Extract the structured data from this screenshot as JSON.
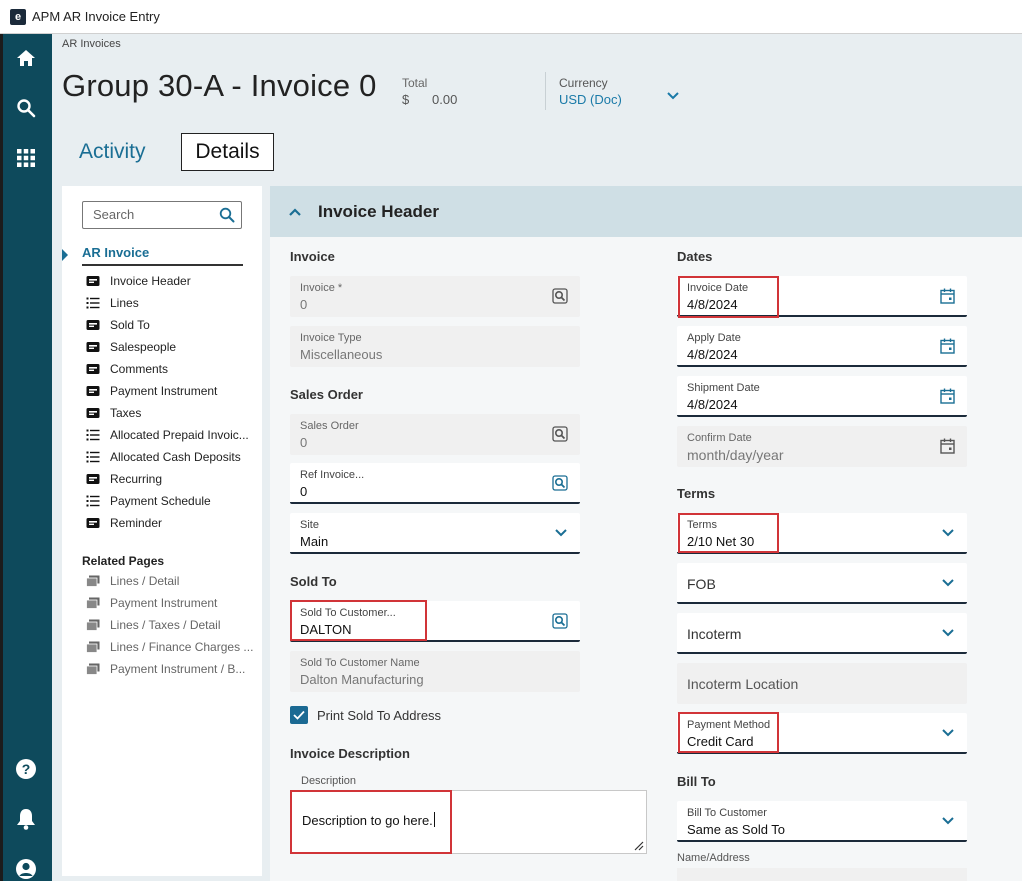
{
  "window": {
    "title": "APM AR Invoice Entry",
    "app_icon_letter": "e"
  },
  "rail": {
    "icons": [
      "home-icon",
      "search-icon",
      "apps-grid-icon",
      "help-icon",
      "bell-icon",
      "user-icon"
    ]
  },
  "header": {
    "breadcrumb": "AR Invoices",
    "title": "Group 30-A - Invoice 0",
    "total_label": "Total",
    "total_currency_symbol": "$",
    "total_value": "0.00",
    "currency_label": "Currency",
    "currency_value": "USD (Doc)"
  },
  "tabs": {
    "activity": "Activity",
    "details": "Details",
    "active": "Details"
  },
  "nav": {
    "search_placeholder": "Search",
    "section": "AR Invoice",
    "items": [
      {
        "label": "Invoice Header",
        "icon": "card-icon"
      },
      {
        "label": "Lines",
        "icon": "list-icon"
      },
      {
        "label": "Sold To",
        "icon": "card-icon"
      },
      {
        "label": "Salespeople",
        "icon": "card-icon"
      },
      {
        "label": "Comments",
        "icon": "card-icon"
      },
      {
        "label": "Payment Instrument",
        "icon": "card-icon"
      },
      {
        "label": "Taxes",
        "icon": "card-icon"
      },
      {
        "label": "Allocated Prepaid Invoic...",
        "icon": "list-icon"
      },
      {
        "label": "Allocated Cash Deposits",
        "icon": "list-icon"
      },
      {
        "label": "Recurring",
        "icon": "card-icon"
      },
      {
        "label": "Payment Schedule",
        "icon": "list-icon"
      },
      {
        "label": "Reminder",
        "icon": "card-icon"
      }
    ],
    "related_title": "Related Pages",
    "related": [
      {
        "label": "Lines / Detail"
      },
      {
        "label": "Payment Instrument"
      },
      {
        "label": "Lines / Taxes / Detail"
      },
      {
        "label": "Lines / Finance Charges ..."
      },
      {
        "label": "Payment Instrument / B..."
      }
    ]
  },
  "section": {
    "title": "Invoice Header"
  },
  "left": {
    "invoice_group": "Invoice",
    "invoice": {
      "label": "Invoice *",
      "value": "0"
    },
    "invoice_type": {
      "label": "Invoice Type",
      "value": "Miscellaneous"
    },
    "sales_order_group": "Sales Order",
    "sales_order": {
      "label": "Sales Order",
      "value": "0"
    },
    "ref_invoice": {
      "label": "Ref Invoice...",
      "value": "0"
    },
    "site": {
      "label": "Site",
      "value": "Main"
    },
    "sold_to_group": "Sold To",
    "sold_to_customer": {
      "label": "Sold To Customer...",
      "value": "DALTON"
    },
    "sold_to_name": {
      "label": "Sold To Customer Name",
      "value": "Dalton Manufacturing"
    },
    "print_address": {
      "label": "Print Sold To Address",
      "checked": true
    },
    "description_group": "Invoice Description",
    "description": {
      "label": "Description",
      "value": "Description to go here."
    }
  },
  "right": {
    "dates_group": "Dates",
    "invoice_date": {
      "label": "Invoice Date",
      "value": "4/8/2024"
    },
    "apply_date": {
      "label": "Apply Date",
      "value": "4/8/2024"
    },
    "shipment_date": {
      "label": "Shipment Date",
      "value": "4/8/2024"
    },
    "confirm_date": {
      "label": "Confirm Date",
      "value": "month/day/year"
    },
    "terms_group": "Terms",
    "terms": {
      "label": "Terms",
      "value": "2/10 Net 30"
    },
    "fob": {
      "placeholder": "FOB"
    },
    "incoterm": {
      "placeholder": "Incoterm"
    },
    "incoterm_location": {
      "placeholder": "Incoterm Location"
    },
    "payment_method": {
      "label": "Payment Method",
      "value": "Credit Card"
    },
    "bill_to_group": "Bill To",
    "bill_to_customer": {
      "label": "Bill To Customer",
      "value": "Same as Sold To"
    },
    "name_address": {
      "label": "Name/Address"
    }
  },
  "colors": {
    "rail": "#0e4a5c",
    "accent": "#1a6e94",
    "highlight": "#d13438",
    "section_header": "#cfdfe5"
  }
}
